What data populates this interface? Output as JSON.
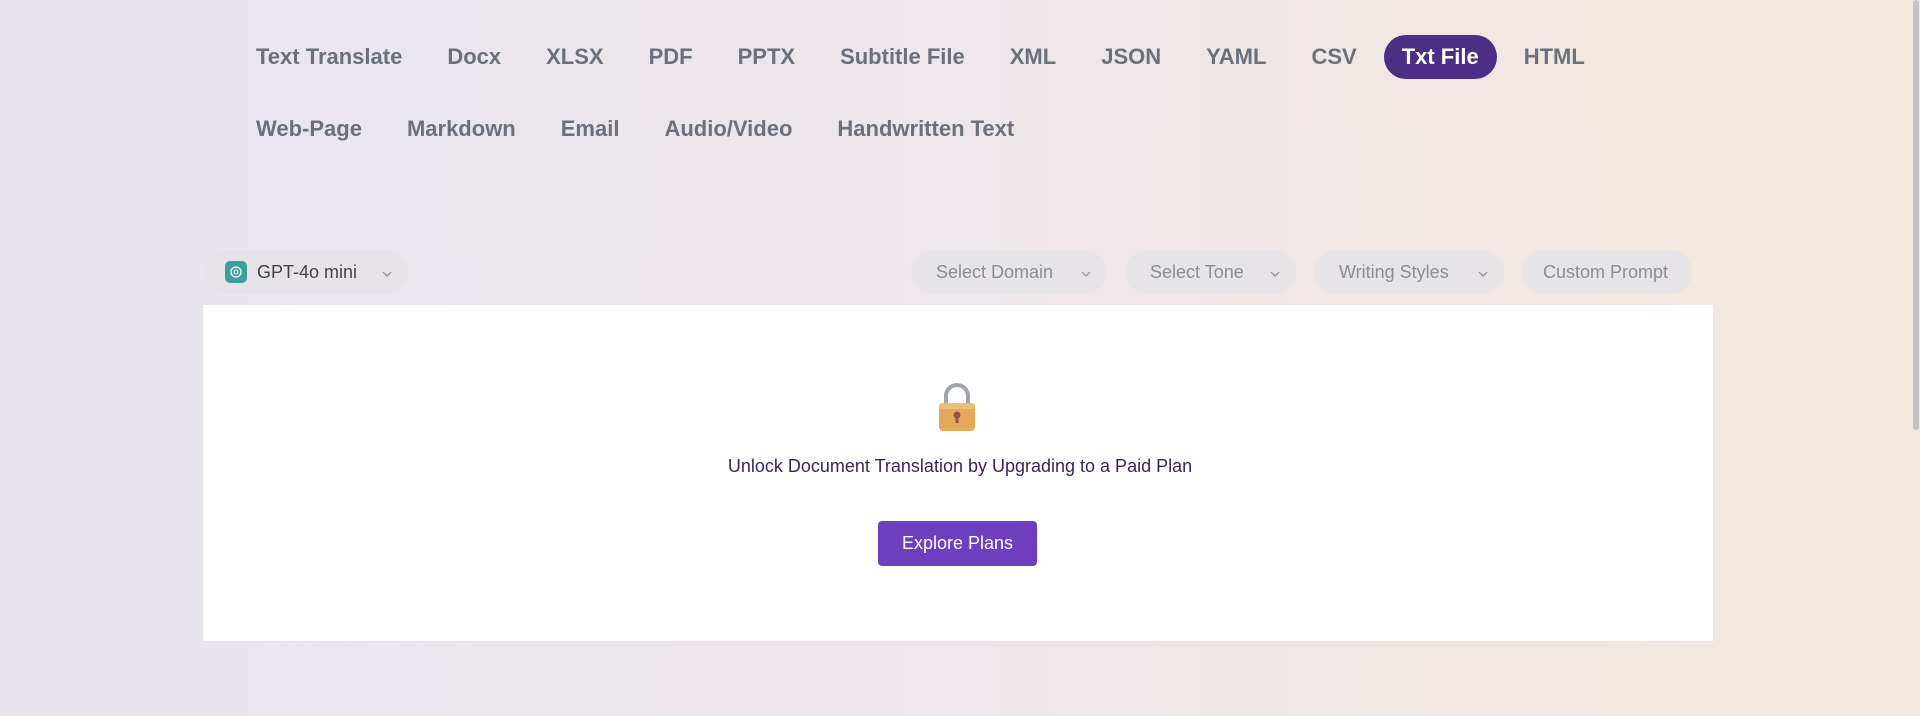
{
  "tabs_row1": [
    {
      "label": "Text Translate",
      "active": false
    },
    {
      "label": "Docx",
      "active": false
    },
    {
      "label": "XLSX",
      "active": false
    },
    {
      "label": "PDF",
      "active": false
    },
    {
      "label": "PPTX",
      "active": false
    },
    {
      "label": "Subtitle File",
      "active": false
    },
    {
      "label": "XML",
      "active": false
    },
    {
      "label": "JSON",
      "active": false
    },
    {
      "label": "YAML",
      "active": false
    },
    {
      "label": "CSV",
      "active": false
    },
    {
      "label": "Txt File",
      "active": true
    },
    {
      "label": "HTML",
      "active": false
    }
  ],
  "tabs_row2": [
    {
      "label": "Web-Page",
      "active": false
    },
    {
      "label": "Markdown",
      "active": false
    },
    {
      "label": "Email",
      "active": false
    },
    {
      "label": "Audio/Video",
      "active": false
    },
    {
      "label": "Handwritten Text",
      "active": false
    }
  ],
  "model_select": {
    "value": "GPT-4o mini",
    "icon": "openai-logo-icon"
  },
  "options": {
    "domain": "Select Domain",
    "tone": "Select Tone",
    "writing_styles": "Writing Styles",
    "custom_prompt": "Custom Prompt"
  },
  "locked_panel": {
    "icon": "lock-icon",
    "message": "Unlock Document Translation by Upgrading to a Paid Plan",
    "button_label": "Explore Plans"
  },
  "colors": {
    "active_tab": "#4d2e85",
    "button": "#6e3fbf",
    "message": "#3b1f66"
  }
}
